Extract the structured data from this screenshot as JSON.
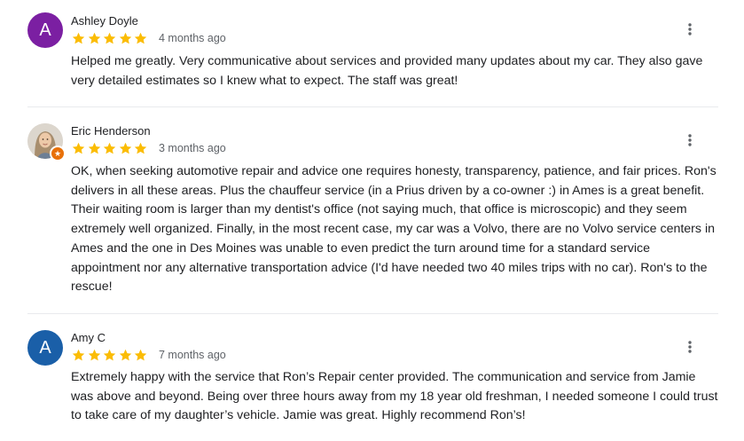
{
  "reviews": [
    {
      "author": "Ashley Doyle",
      "avatar_letter": "A",
      "avatar_color": "#7b1fa2",
      "rating": 5,
      "date": "4 months ago",
      "text": "Helped me greatly. Very communicative about services and provided many updates about my car. They also gave very detailed estimates so I knew what to expect. The staff was great!"
    },
    {
      "author": "Eric Henderson",
      "avatar_type": "photo",
      "local_guide": true,
      "rating": 5,
      "date": "3 months ago",
      "text": "OK, when seeking automotive repair and advice one requires honesty, transparency, patience, and fair prices. Ron's delivers in all these areas. Plus the chauffeur service (in a Prius driven by a co-owner :) in Ames is a great benefit. Their waiting room is larger than my dentist's office (not saying much, that office is microscopic) and they seem extremely well organized. Finally, in the most recent case, my car was a Volvo, there are no Volvo service centers in Ames and the one in Des Moines was unable to even predict the turn around time for a standard service appointment nor any alternative transportation advice (I'd have needed two 40 miles trips with no car). Ron's to the rescue!"
    },
    {
      "author": "Amy C",
      "avatar_letter": "A",
      "avatar_color": "#1a5fa8",
      "rating": 5,
      "date": "7 months ago",
      "text": "Extremely happy with the service that Ron’s Repair center provided. The communication and service from Jamie was above and beyond. Being over three hours away from my 18 year old freshman, I needed someone I could trust to take care of my daughter’s vehicle. Jamie was great. Highly recommend Ron’s!"
    }
  ],
  "colors": {
    "star": "#fbbc04",
    "divider": "#e8eaed",
    "secondary_text": "#5f6368"
  },
  "icons": {
    "star": "star-icon",
    "more": "more-vert-icon"
  }
}
